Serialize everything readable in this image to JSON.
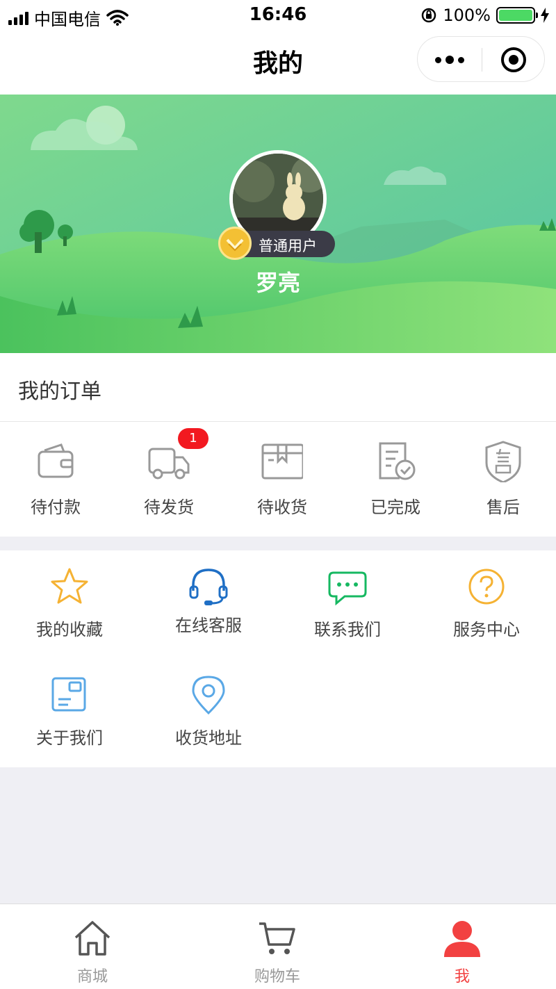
{
  "status_bar": {
    "carrier": "中国电信",
    "time": "16:46",
    "battery": "100%",
    "signal_icon": "signal-icon",
    "wifi_icon": "wifi-icon",
    "battery_fill": 1.0
  },
  "nav": {
    "title": "我的",
    "more_icon": "more-dots-icon",
    "close_icon": "target-close-icon"
  },
  "profile": {
    "level_badge": "普通用户",
    "name": "罗亮"
  },
  "orders": {
    "title": "我的订单",
    "items": [
      {
        "label": "待付款",
        "icon": "wallet-icon"
      },
      {
        "label": "待发货",
        "icon": "truck-icon",
        "badge": "1"
      },
      {
        "label": "待收货",
        "icon": "box-icon"
      },
      {
        "label": "已完成",
        "icon": "receipt-check-icon"
      },
      {
        "label": "售后",
        "icon": "shield-after-sale-icon"
      }
    ]
  },
  "services": [
    {
      "label": "我的收藏",
      "icon": "star-icon",
      "color": "#f5b233"
    },
    {
      "label": "在线客服",
      "icon": "headset-icon",
      "color": "#1f6fc5"
    },
    {
      "label": "联系我们",
      "icon": "chat-icon",
      "color": "#16b861"
    },
    {
      "label": "服务中心",
      "icon": "question-icon",
      "color": "#f5b233"
    },
    {
      "label": "关于我们",
      "icon": "card-icon",
      "color": "#5aa8e6"
    },
    {
      "label": "收货地址",
      "icon": "location-pin-icon",
      "color": "#5aa8e6"
    }
  ],
  "tabbar": {
    "items": [
      {
        "label": "商城",
        "icon": "home-icon"
      },
      {
        "label": "购物车",
        "icon": "cart-icon"
      },
      {
        "label": "我",
        "icon": "user-icon",
        "active": true
      }
    ],
    "active_color": "#f24141"
  }
}
